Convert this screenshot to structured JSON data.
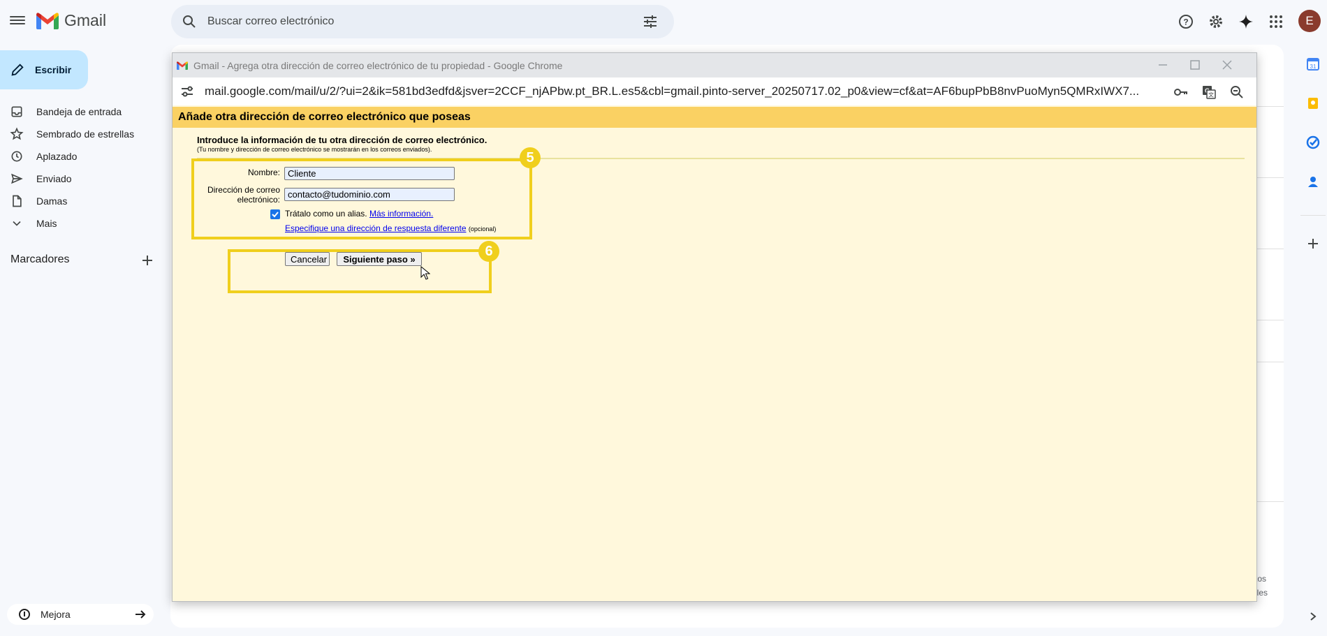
{
  "gmail": {
    "app_name": "Gmail",
    "search_placeholder": "Buscar correo electrónico",
    "avatar_letter": "E",
    "compose_label": "Escribir",
    "nav": [
      {
        "label": "Bandeja de entrada",
        "icon": "inbox-icon"
      },
      {
        "label": "Sembrado de estrellas",
        "icon": "star-icon"
      },
      {
        "label": "Aplazado",
        "icon": "clock-icon"
      },
      {
        "label": "Enviado",
        "icon": "send-icon"
      },
      {
        "label": "Damas",
        "icon": "draft-icon"
      },
      {
        "label": "Mais",
        "icon": "chevron-down-icon"
      }
    ],
    "labels_heading": "Marcadores",
    "upgrade_label": "Mejora",
    "partial_right_text": [
      "tos",
      "lles"
    ],
    "brand_colors": {
      "accent": "#c2e7ff",
      "logo_red": "#ea4335",
      "logo_blue": "#4285f4",
      "logo_yellow": "#fbbc04",
      "logo_green": "#34a853"
    }
  },
  "popup": {
    "window_title": "Gmail - Agrega otra dirección de correo electrónico de tu propiedad - Google Chrome",
    "url": "mail.google.com/mail/u/2/?ui=2&ik=581bd3edfd&jsver=2CCF_njAPbw.pt_BR.L.es5&cbl=gmail.pinto-server_20250717.02_p0&view=cf&at=AF6bupPbB8nvPuoMyn5QMRxIWX7...",
    "header": "Añade otra dirección de correo electrónico que poseas",
    "intro": "Introduce la información de tu otra dirección de correo electrónico.",
    "intro_sub": "(Tu nombre y dirección de correo electrónico se mostrarán en los correos enviados).",
    "form": {
      "name_label": "Nombre:",
      "name_value": "Cliente",
      "email_label": "Dirección de correo electrónico:",
      "email_value": "contacto@tudominio.com",
      "alias_checked": true,
      "alias_label": "Trátalo como un alias.",
      "alias_link": "Más información.",
      "reply_link": "Especifique una dirección de respuesta diferente",
      "reply_optional": "(opcional)"
    },
    "buttons": {
      "cancel": "Cancelar",
      "next": "Siguiente paso »"
    },
    "annotations": {
      "step_form": "5",
      "step_buttons": "6",
      "highlight_color": "#f0cf1d"
    },
    "colors": {
      "header_bg": "#fad163",
      "body_bg": "#fff8dc"
    }
  }
}
